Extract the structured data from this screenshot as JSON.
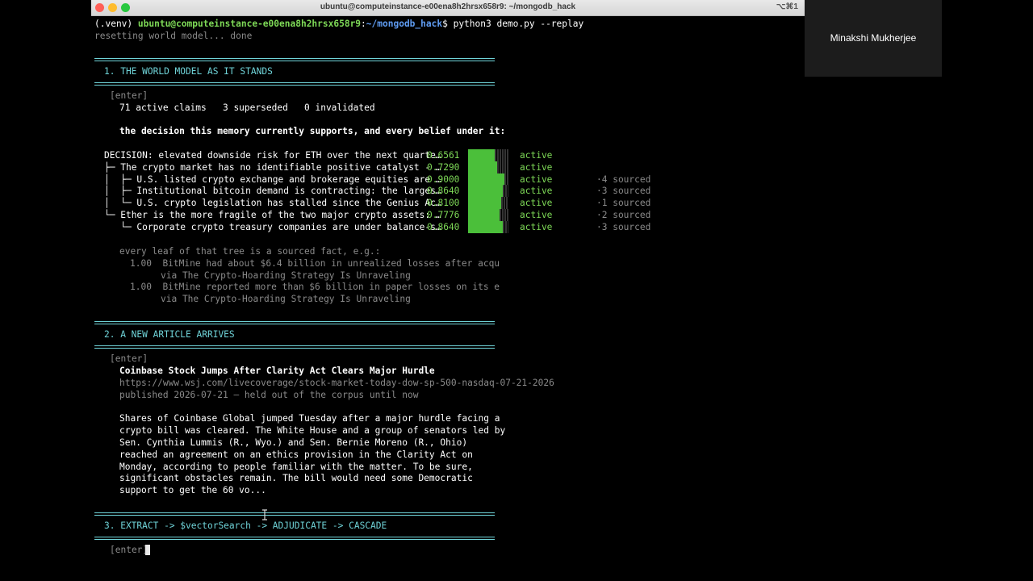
{
  "window": {
    "title": "ubuntu@computeinstance-e00ena8h2hrsx658r9: ~/mongodb_hack",
    "shortcut": "⌥⌘1"
  },
  "prompt": {
    "venv": "(.venv) ",
    "user": "ubuntu@computeinstance-e00ena8h2hrsx658r9",
    "sep": ":",
    "path": "~/mongodb_hack",
    "dollar": "$ ",
    "command": "python3 demo.py --replay"
  },
  "reset_line": "resetting world model... done",
  "section1": {
    "heading": "1. THE WORLD MODEL AS IT STANDS",
    "enter": "[enter]",
    "counts": "71 active claims   3 superseded   0 invalidated",
    "decision_intro": "the decision this memory currently supports, and every belief under it:",
    "tree": [
      {
        "prefix": "DECISION: ",
        "text": "elevated downside risk for ETH over the next quarte…",
        "score": "0.6561",
        "fill": 0.6561,
        "status": "active",
        "sourced": ""
      },
      {
        "prefix": "├─ ",
        "text": "The crypto market has no identifiable positive catalyst - …",
        "score": "0.7290",
        "fill": 0.729,
        "status": "active",
        "sourced": ""
      },
      {
        "prefix": "│  ├─ ",
        "text": "U.S. listed crypto exchange and brokerage equities are …",
        "score": "0.9000",
        "fill": 0.9,
        "status": "active",
        "sourced": "·4 sourced"
      },
      {
        "prefix": "│  ├─ ",
        "text": "Institutional bitcoin demand is contracting: the larges…",
        "score": "0.8640",
        "fill": 0.864,
        "status": "active",
        "sourced": "·3 sourced"
      },
      {
        "prefix": "│  └─ ",
        "text": "U.S. crypto legislation has stalled since the Genius Ac…",
        "score": "0.8100",
        "fill": 0.81,
        "status": "active",
        "sourced": "·1 sourced"
      },
      {
        "prefix": "└─ ",
        "text": "Ether is the more fragile of the two major crypto assets: …",
        "score": "0.7776",
        "fill": 0.7776,
        "status": "active",
        "sourced": "·2 sourced"
      },
      {
        "prefix": "   └─ ",
        "text": "Corporate crypto treasury companies are under balance-s…",
        "score": "0.8640",
        "fill": 0.864,
        "status": "active",
        "sourced": "·3 sourced"
      }
    ],
    "leaf_intro": "every leaf of that tree is a sourced fact, e.g.:",
    "facts": [
      {
        "score": "1.00",
        "text": "BitMine had about $6.4 billion in unrealized losses after acqu",
        "via": "via The Crypto-Hoarding Strategy Is Unraveling"
      },
      {
        "score": "1.00",
        "text": "BitMine reported more than $6 billion in paper losses on its e",
        "via": "via The Crypto-Hoarding Strategy Is Unraveling"
      }
    ]
  },
  "section2": {
    "heading": "2. A NEW ARTICLE ARRIVES",
    "enter": "[enter]",
    "headline": "Coinbase Stock Jumps After Clarity Act Clears Major Hurdle",
    "url": "https://www.wsj.com/livecoverage/stock-market-today-dow-sp-500-nasdaq-07-21-2026",
    "published": "published 2026-07-21 — held out of the corpus until now",
    "body": [
      "Shares of Coinbase Global jumped Tuesday after a major hurdle facing a",
      "crypto bill was cleared. The White House and a group of senators led by",
      "Sen. Cynthia Lummis (R., Wyo.) and Sen. Bernie Moreno (R., Ohio)",
      "reached an agreement on an ethics provision in the Clarity Act on",
      "Monday, according to people familiar with the matter. To be sure,",
      "significant obstacles remain. The bill would need some Democratic",
      "support to get the 60 vo..."
    ]
  },
  "section3": {
    "heading": "3. EXTRACT -> $vectorSearch -> ADJUDICATE -> CASCADE",
    "enter": "[enter]"
  },
  "participant": {
    "name": "Minakshi Mukherjee"
  }
}
